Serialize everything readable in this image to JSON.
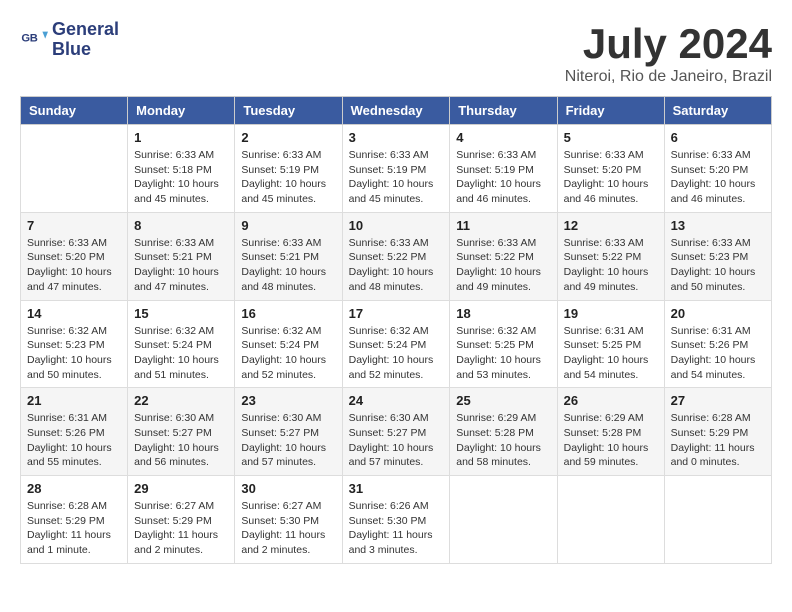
{
  "logo": {
    "line1": "General",
    "line2": "Blue"
  },
  "title": "July 2024",
  "location": "Niteroi, Rio de Janeiro, Brazil",
  "headers": [
    "Sunday",
    "Monday",
    "Tuesday",
    "Wednesday",
    "Thursday",
    "Friday",
    "Saturday"
  ],
  "weeks": [
    [
      {
        "day": "",
        "info": ""
      },
      {
        "day": "1",
        "info": "Sunrise: 6:33 AM\nSunset: 5:18 PM\nDaylight: 10 hours\nand 45 minutes."
      },
      {
        "day": "2",
        "info": "Sunrise: 6:33 AM\nSunset: 5:19 PM\nDaylight: 10 hours\nand 45 minutes."
      },
      {
        "day": "3",
        "info": "Sunrise: 6:33 AM\nSunset: 5:19 PM\nDaylight: 10 hours\nand 45 minutes."
      },
      {
        "day": "4",
        "info": "Sunrise: 6:33 AM\nSunset: 5:19 PM\nDaylight: 10 hours\nand 46 minutes."
      },
      {
        "day": "5",
        "info": "Sunrise: 6:33 AM\nSunset: 5:20 PM\nDaylight: 10 hours\nand 46 minutes."
      },
      {
        "day": "6",
        "info": "Sunrise: 6:33 AM\nSunset: 5:20 PM\nDaylight: 10 hours\nand 46 minutes."
      }
    ],
    [
      {
        "day": "7",
        "info": "Sunrise: 6:33 AM\nSunset: 5:20 PM\nDaylight: 10 hours\nand 47 minutes."
      },
      {
        "day": "8",
        "info": "Sunrise: 6:33 AM\nSunset: 5:21 PM\nDaylight: 10 hours\nand 47 minutes."
      },
      {
        "day": "9",
        "info": "Sunrise: 6:33 AM\nSunset: 5:21 PM\nDaylight: 10 hours\nand 48 minutes."
      },
      {
        "day": "10",
        "info": "Sunrise: 6:33 AM\nSunset: 5:22 PM\nDaylight: 10 hours\nand 48 minutes."
      },
      {
        "day": "11",
        "info": "Sunrise: 6:33 AM\nSunset: 5:22 PM\nDaylight: 10 hours\nand 49 minutes."
      },
      {
        "day": "12",
        "info": "Sunrise: 6:33 AM\nSunset: 5:22 PM\nDaylight: 10 hours\nand 49 minutes."
      },
      {
        "day": "13",
        "info": "Sunrise: 6:33 AM\nSunset: 5:23 PM\nDaylight: 10 hours\nand 50 minutes."
      }
    ],
    [
      {
        "day": "14",
        "info": "Sunrise: 6:32 AM\nSunset: 5:23 PM\nDaylight: 10 hours\nand 50 minutes."
      },
      {
        "day": "15",
        "info": "Sunrise: 6:32 AM\nSunset: 5:24 PM\nDaylight: 10 hours\nand 51 minutes."
      },
      {
        "day": "16",
        "info": "Sunrise: 6:32 AM\nSunset: 5:24 PM\nDaylight: 10 hours\nand 52 minutes."
      },
      {
        "day": "17",
        "info": "Sunrise: 6:32 AM\nSunset: 5:24 PM\nDaylight: 10 hours\nand 52 minutes."
      },
      {
        "day": "18",
        "info": "Sunrise: 6:32 AM\nSunset: 5:25 PM\nDaylight: 10 hours\nand 53 minutes."
      },
      {
        "day": "19",
        "info": "Sunrise: 6:31 AM\nSunset: 5:25 PM\nDaylight: 10 hours\nand 54 minutes."
      },
      {
        "day": "20",
        "info": "Sunrise: 6:31 AM\nSunset: 5:26 PM\nDaylight: 10 hours\nand 54 minutes."
      }
    ],
    [
      {
        "day": "21",
        "info": "Sunrise: 6:31 AM\nSunset: 5:26 PM\nDaylight: 10 hours\nand 55 minutes."
      },
      {
        "day": "22",
        "info": "Sunrise: 6:30 AM\nSunset: 5:27 PM\nDaylight: 10 hours\nand 56 minutes."
      },
      {
        "day": "23",
        "info": "Sunrise: 6:30 AM\nSunset: 5:27 PM\nDaylight: 10 hours\nand 57 minutes."
      },
      {
        "day": "24",
        "info": "Sunrise: 6:30 AM\nSunset: 5:27 PM\nDaylight: 10 hours\nand 57 minutes."
      },
      {
        "day": "25",
        "info": "Sunrise: 6:29 AM\nSunset: 5:28 PM\nDaylight: 10 hours\nand 58 minutes."
      },
      {
        "day": "26",
        "info": "Sunrise: 6:29 AM\nSunset: 5:28 PM\nDaylight: 10 hours\nand 59 minutes."
      },
      {
        "day": "27",
        "info": "Sunrise: 6:28 AM\nSunset: 5:29 PM\nDaylight: 11 hours\nand 0 minutes."
      }
    ],
    [
      {
        "day": "28",
        "info": "Sunrise: 6:28 AM\nSunset: 5:29 PM\nDaylight: 11 hours\nand 1 minute."
      },
      {
        "day": "29",
        "info": "Sunrise: 6:27 AM\nSunset: 5:29 PM\nDaylight: 11 hours\nand 2 minutes."
      },
      {
        "day": "30",
        "info": "Sunrise: 6:27 AM\nSunset: 5:30 PM\nDaylight: 11 hours\nand 2 minutes."
      },
      {
        "day": "31",
        "info": "Sunrise: 6:26 AM\nSunset: 5:30 PM\nDaylight: 11 hours\nand 3 minutes."
      },
      {
        "day": "",
        "info": ""
      },
      {
        "day": "",
        "info": ""
      },
      {
        "day": "",
        "info": ""
      }
    ]
  ]
}
